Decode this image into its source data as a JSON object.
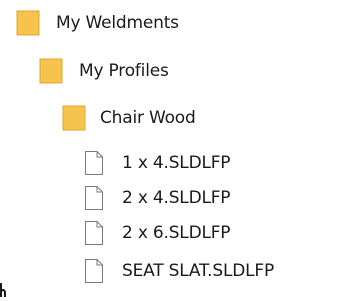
{
  "tree": {
    "colors": {
      "folder_fill": "#f6c34d",
      "folder_edge": "#e0a52e",
      "file_fill": "#ffffff",
      "file_edge": "#7a7a7a",
      "text": "#1a1a1a"
    },
    "nodes": [
      {
        "label": "My Weldments",
        "icon": "folder-icon",
        "kind": "folder",
        "depth": 0
      },
      {
        "label": "My Profiles",
        "icon": "folder-icon",
        "kind": "folder",
        "depth": 1
      },
      {
        "label": "Chair Wood",
        "icon": "folder-icon",
        "kind": "folder",
        "depth": 2
      },
      {
        "label": "1 x 4.SLDLFP",
        "icon": "file-icon",
        "kind": "file",
        "depth": 3
      },
      {
        "label": "2 x 4.SLDLFP",
        "icon": "file-icon",
        "kind": "file",
        "depth": 3
      },
      {
        "label": "2 x 6.SLDLFP",
        "icon": "file-icon",
        "kind": "file",
        "depth": 3
      },
      {
        "label": "SEAT SLAT.SLDLFP",
        "icon": "file-icon",
        "kind": "file",
        "depth": 3
      }
    ]
  }
}
